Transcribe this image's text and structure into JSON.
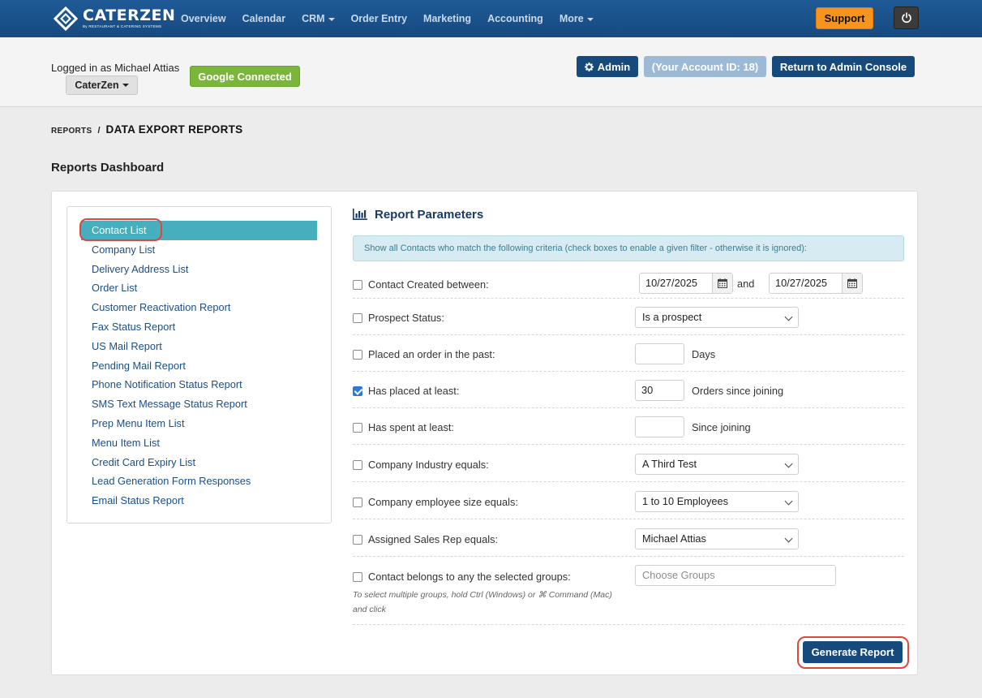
{
  "brand": {
    "name": "CATERZEN",
    "sub": "By RESTAURANT & CATERING SYSTEMS"
  },
  "nav": {
    "items": [
      {
        "label": "Overview"
      },
      {
        "label": "Calendar"
      },
      {
        "label": "CRM"
      },
      {
        "label": "Order Entry"
      },
      {
        "label": "Marketing"
      },
      {
        "label": "Accounting"
      },
      {
        "label": "More"
      }
    ],
    "support_label": "Support"
  },
  "subheader": {
    "logged_in": "Logged in as Michael Attias",
    "org": "CaterZen",
    "google": "Google Connected",
    "admin": "Admin",
    "account_id": "(Your Account ID: 18)",
    "return": "Return to Admin Console"
  },
  "breadcrumb": {
    "parent": "REPORTS",
    "separator": "/",
    "current": "DATA EXPORT REPORTS"
  },
  "page_title": "Reports Dashboard",
  "sidebar": {
    "items": [
      {
        "label": "Contact List",
        "active": true
      },
      {
        "label": "Company List"
      },
      {
        "label": "Delivery Address List"
      },
      {
        "label": "Order List"
      },
      {
        "label": "Customer Reactivation Report"
      },
      {
        "label": "Fax Status Report"
      },
      {
        "label": "US Mail Report"
      },
      {
        "label": "Pending Mail Report"
      },
      {
        "label": "Phone Notification Status Report"
      },
      {
        "label": "SMS Text Message Status Report"
      },
      {
        "label": "Prep Menu Item List"
      },
      {
        "label": "Menu Item List"
      },
      {
        "label": "Credit Card Expiry List"
      },
      {
        "label": "Lead Generation Form Responses"
      },
      {
        "label": "Email Status Report"
      }
    ]
  },
  "params": {
    "title": "Report Parameters",
    "info": "Show all Contacts who match the following criteria (check boxes to enable a given filter - otherwise it is ignored):",
    "contact_created": {
      "label": "Contact Created between:",
      "checked": false,
      "from": "10/27/2025",
      "and": "and",
      "to": "10/27/2025"
    },
    "prospect": {
      "label": "Prospect Status:",
      "checked": false,
      "value": "Is a prospect"
    },
    "placed_order": {
      "label": "Placed an order in the past:",
      "checked": false,
      "value": "",
      "suffix": "Days"
    },
    "has_placed": {
      "label": "Has placed at least:",
      "checked": true,
      "value": "30",
      "suffix": "Orders since joining"
    },
    "has_spent": {
      "label": "Has spent at least:",
      "checked": false,
      "value": "",
      "suffix": "Since joining"
    },
    "industry": {
      "label": "Company Industry equals:",
      "checked": false,
      "value": "A Third Test"
    },
    "employee_size": {
      "label": "Company employee size equals:",
      "checked": false,
      "value": "1 to 10 Employees"
    },
    "sales_rep": {
      "label": "Assigned Sales Rep equals:",
      "checked": false,
      "value": "Michael Attias"
    },
    "groups": {
      "label": "Contact belongs to any the selected groups:",
      "checked": false,
      "placeholder": "Choose Groups",
      "help": "To select multiple groups, hold Ctrl (Windows) or ⌘ Command (Mac) and click"
    },
    "generate_label": "Generate Report"
  }
}
